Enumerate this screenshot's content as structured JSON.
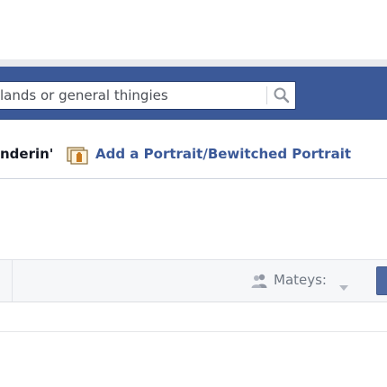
{
  "header": {
    "search": {
      "value": "lands or general thingies",
      "button_icon": "magnifier-icon"
    }
  },
  "composer": {
    "name_fragment": "nderin'",
    "portrait_icon": "portrait-frame-icon",
    "portrait_link": "Add a Portrait/Bewitched Portrait"
  },
  "friends_bar": {
    "mateys_icon": "friends-icon",
    "mateys_label": "Mateys:",
    "dropdown_icon": "caret-down-icon"
  },
  "colors": {
    "brand_blue": "#3b5998",
    "link_blue": "#3b5998",
    "text_dark": "#141823",
    "muted_text": "#6f7782"
  }
}
